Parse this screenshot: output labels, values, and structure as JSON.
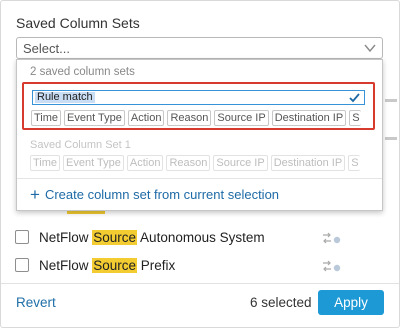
{
  "panel": {
    "title": "Saved Column Sets",
    "select_placeholder": "Select..."
  },
  "dropdown": {
    "count_label": "2 saved column sets",
    "editing_set": {
      "name": "Rule match",
      "columns": [
        "Time",
        "Event Type",
        "Action",
        "Reason",
        "Source IP",
        "Destination IP",
        "S"
      ]
    },
    "other_set": {
      "name": "Saved Column Set 1",
      "columns": [
        "Time",
        "Event Type",
        "Action",
        "Reason",
        "Source IP",
        "Destination IP",
        "S"
      ]
    },
    "create_label": "Create column set from current selection"
  },
  "list": {
    "items": [
      {
        "prefix": "NetFlow ",
        "highlight": "Source",
        "suffix": " Autonomous System"
      },
      {
        "prefix": "NetFlow ",
        "highlight": "Source",
        "suffix": " Prefix"
      }
    ]
  },
  "footer": {
    "revert": "Revert",
    "selected_count": "6 selected",
    "apply": "Apply"
  },
  "colors": {
    "accent": "#1d9ad6",
    "link": "#1e6aa6",
    "highlight": "#f2cc30",
    "focus_border": "#d93a2e"
  },
  "icons": [
    "chevron-down-icon",
    "checkmark-icon",
    "plus-icon",
    "column-arrows-icon"
  ]
}
